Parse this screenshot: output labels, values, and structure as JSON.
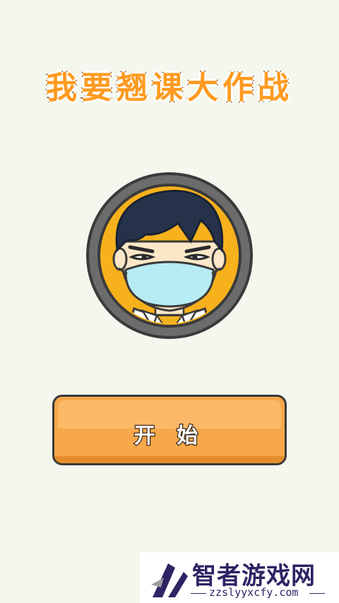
{
  "title": "我要翘课大作战",
  "start_button": {
    "label": "开 始"
  },
  "watermark": {
    "name": "智者游戏网",
    "url": "zzslyyxcfy.com"
  },
  "colors": {
    "background": "#f4f7ee",
    "title_fill": "#ff9a1f",
    "button": "#f6a84a",
    "avatar_ring": "#6c6c6c",
    "avatar_bg": "#f7b11c",
    "mask": "#b7ecf5"
  },
  "icons": {
    "avatar": "masked-student-avatar",
    "watermark_logo": "zhizhe-logo-icon"
  }
}
